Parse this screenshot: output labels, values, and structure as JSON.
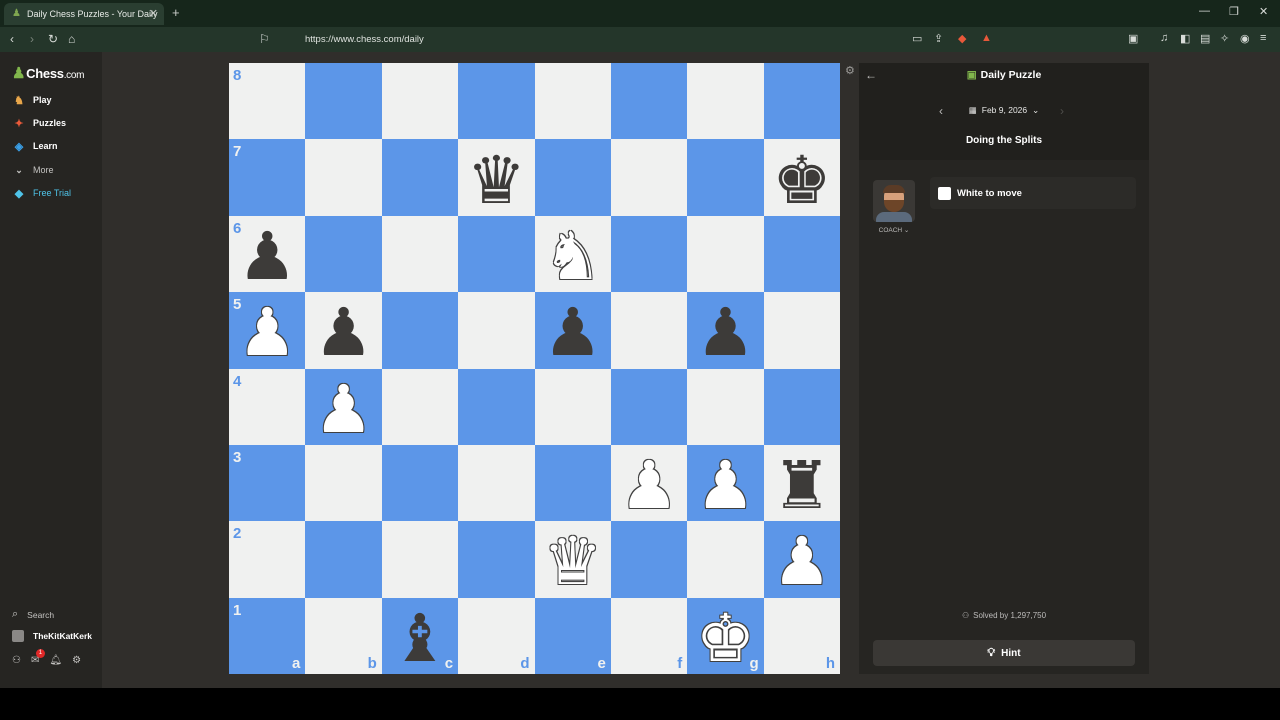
{
  "browser": {
    "tab_title": "Daily Chess Puzzles - Your Daily",
    "url": "https://www.chess.com/daily"
  },
  "sidebar": {
    "logo": "Chess",
    "logo_suffix": ".com",
    "items": [
      {
        "label": "Play",
        "icon": "play-icon"
      },
      {
        "label": "Puzzles",
        "icon": "puzzles-icon"
      },
      {
        "label": "Learn",
        "icon": "learn-icon"
      },
      {
        "label": "More",
        "icon": "chevron-down-icon"
      },
      {
        "label": "Free Trial",
        "icon": "diamond-icon"
      }
    ],
    "search_label": "Search",
    "username": "TheKitKatKerk",
    "notification_count": "1"
  },
  "board": {
    "ranks": [
      "8",
      "7",
      "6",
      "5",
      "4",
      "3",
      "2",
      "1"
    ],
    "files": [
      "a",
      "b",
      "c",
      "d",
      "e",
      "f",
      "g",
      "h"
    ],
    "pieces": {
      "d7": "bq",
      "h7": "bk",
      "a6": "bp",
      "e6": "wn",
      "a5": "wp",
      "b5": "bp",
      "e5": "bp",
      "g5": "bp",
      "b4": "wp",
      "f3": "wp",
      "g3": "wp",
      "h3": "br",
      "e2": "wq",
      "h2": "wp",
      "c1": "bb",
      "g1": "wk"
    },
    "colors": {
      "light": "#f0f1f0",
      "dark": "#5c96e8"
    }
  },
  "panel": {
    "title": "Daily Puzzle",
    "date": "Feb 9, 2026",
    "subtitle": "Doing the Splits",
    "coach_label": "COACH",
    "to_move": "White to move",
    "solved": "Solved by 1,297,750",
    "hint": "Hint"
  }
}
